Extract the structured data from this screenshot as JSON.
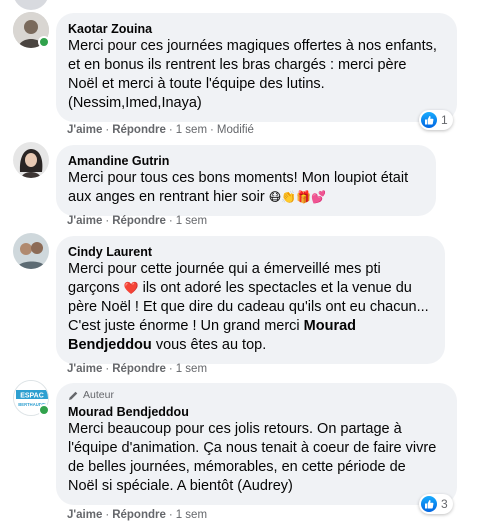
{
  "comments": [
    {
      "author": "Kaotar Zouina",
      "lines": [
        "Merci pour ces journées magiques offertes à nos enfants,",
        "et en bonus ils rentrent les bras chargés : merci père",
        "Noël et merci à toute l'équipe des lutins.",
        "(Nessim,Imed,Inaya)"
      ],
      "like_label": "J'aime",
      "reply_label": "Répondre",
      "time": "1 sem",
      "edited": "Modifié",
      "reaction_count": "1"
    },
    {
      "author": "Amandine Gutrin",
      "lines": [
        "Merci pour tous ces bons moments! Mon loupiot était",
        "aux anges en rentrant hier soir"
      ],
      "emojis": [
        "😷",
        "👏",
        "🎁",
        "💕"
      ],
      "like_label": "J'aime",
      "reply_label": "Répondre",
      "time": "1 sem"
    },
    {
      "author": "Cindy Laurent",
      "lines": [
        "Merci pour cette journée qui a émerveillé mes pti",
        "garçons",
        "ils ont adoré les spectacles et la venue du",
        "père Noël ! Et que dire du cadeau qu'ils ont eu chacun...",
        "C'est juste énorme ! Un grand merci",
        "Mourad",
        "Bendjeddou",
        "vous êtes au top."
      ],
      "heart": "❤️",
      "like_label": "J'aime",
      "reply_label": "Répondre",
      "time": "1 sem"
    },
    {
      "badge": "Auteur",
      "author": "Mourad Bendjeddou",
      "avatar_text_top": "ESPAC",
      "avatar_text_bottom": "BERTHAUDIE",
      "lines": [
        "Merci beaucoup pour ces jolis retours. On partage à",
        "l'équipe d'animation. Ça nous tenait à coeur de faire vivre",
        "de belles journées, mémorables, en cette période de",
        "Noël si spéciale. A bientôt (Audrey)"
      ],
      "like_label": "J'aime",
      "reply_label": "Répondre",
      "time": "1 sem",
      "reaction_count": "3"
    }
  ],
  "separator": "·",
  "colors": {
    "like_blue": "#1877f2",
    "online_green": "#31a24c",
    "bubble_bg": "#f0f2f5",
    "meta_gray": "#65676b"
  }
}
